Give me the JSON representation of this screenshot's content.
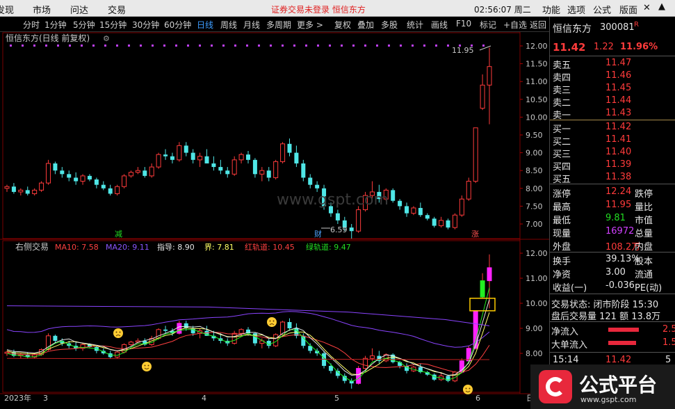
{
  "menu": {
    "items": [
      "发现",
      "市场",
      "问达",
      "交易"
    ],
    "notice": "证券交易未登录  恒信东方",
    "clock": "02:56:07 周二",
    "right_items": [
      "功能",
      "选项",
      "公式",
      "版面"
    ],
    "close": "✕",
    "caret": "▲"
  },
  "toolbar": {
    "items": [
      "分时",
      "1分钟",
      "5分钟",
      "15分钟",
      "30分钟",
      "60分钟",
      "日线",
      "周线",
      "月线",
      "多周期",
      "更多 >",
      "复权",
      "叠加",
      "多股",
      "统计",
      "画线",
      "F10",
      "标记",
      "+自选",
      "返回"
    ],
    "active": "日线"
  },
  "main_chart": {
    "title": "恒信东方(日线 前复权)",
    "high_label": "11.95",
    "low_label": "6.59",
    "markers": {
      "jian": "减",
      "cai": "财",
      "zhang": "涨"
    },
    "y_ticks": [
      "12.00",
      "11.50",
      "11.00",
      "10.50",
      "10.00",
      "9.50",
      "9.00",
      "8.50",
      "8.00",
      "7.50",
      "7.00"
    ]
  },
  "indicator": {
    "name": "右侧交易",
    "ma10_label": "MA10: 7.58",
    "ma20_label": "MA20: 9.11",
    "zhidao_label": "指导: 8.90",
    "jie_label": "界: 7.81",
    "hong_label": "红轨道: 10.45",
    "lv_label": "绿轨道: 9.47",
    "y_ticks": [
      "12.00",
      "11.00",
      "10.00",
      "9.00",
      "8.00"
    ]
  },
  "x_axis": {
    "year": "2023年",
    "months": [
      "3",
      "4",
      "5",
      "6"
    ],
    "end": "日"
  },
  "watermark": "www.gspt.com",
  "chart_data": {
    "type": "candlestick",
    "ylim": [
      6.4,
      12.2
    ],
    "candles": [
      [
        8.0,
        8.1,
        7.9,
        8.05
      ],
      [
        8.05,
        8.15,
        7.85,
        7.9
      ],
      [
        7.9,
        8.0,
        7.8,
        7.95
      ],
      [
        7.95,
        8.05,
        7.8,
        7.85
      ],
      [
        7.85,
        8.0,
        7.8,
        7.95
      ],
      [
        7.95,
        8.2,
        7.9,
        8.15
      ],
      [
        8.15,
        8.8,
        8.1,
        8.7
      ],
      [
        8.7,
        8.75,
        8.4,
        8.5
      ],
      [
        8.5,
        8.6,
        8.3,
        8.4
      ],
      [
        8.4,
        8.5,
        8.2,
        8.3
      ],
      [
        8.3,
        8.45,
        8.1,
        8.2
      ],
      [
        8.2,
        8.4,
        8.1,
        8.35
      ],
      [
        8.35,
        8.4,
        8.2,
        8.25
      ],
      [
        8.25,
        8.3,
        8.0,
        8.1
      ],
      [
        8.1,
        8.2,
        7.95,
        8.0
      ],
      [
        8.0,
        8.1,
        7.8,
        7.85
      ],
      [
        7.85,
        8.1,
        7.8,
        8.05
      ],
      [
        8.05,
        8.4,
        8.0,
        8.35
      ],
      [
        8.35,
        8.5,
        8.3,
        8.45
      ],
      [
        8.45,
        8.6,
        8.4,
        8.5
      ],
      [
        8.5,
        8.6,
        8.3,
        8.35
      ],
      [
        8.35,
        8.7,
        8.3,
        8.6
      ],
      [
        8.6,
        9.0,
        8.55,
        8.95
      ],
      [
        8.95,
        9.1,
        8.8,
        8.9
      ],
      [
        8.9,
        9.0,
        8.7,
        8.8
      ],
      [
        8.8,
        9.3,
        8.75,
        9.2
      ],
      [
        9.2,
        9.3,
        8.9,
        9.0
      ],
      [
        9.0,
        9.1,
        8.7,
        8.8
      ],
      [
        8.8,
        9.0,
        8.6,
        8.9
      ],
      [
        8.9,
        9.1,
        8.7,
        8.7
      ],
      [
        8.7,
        8.9,
        8.5,
        8.6
      ],
      [
        8.6,
        8.8,
        8.4,
        8.5
      ],
      [
        8.5,
        8.6,
        8.3,
        8.4
      ],
      [
        8.4,
        8.9,
        8.35,
        8.8
      ],
      [
        8.8,
        9.0,
        8.7,
        8.95
      ],
      [
        8.95,
        9.05,
        8.7,
        8.8
      ],
      [
        8.8,
        8.85,
        8.3,
        8.4
      ],
      [
        8.4,
        8.6,
        8.2,
        8.5
      ],
      [
        8.5,
        8.6,
        8.2,
        8.3
      ],
      [
        8.3,
        8.8,
        8.25,
        8.75
      ],
      [
        8.75,
        9.3,
        8.7,
        9.25
      ],
      [
        9.25,
        9.4,
        8.9,
        9.0
      ],
      [
        9.0,
        9.2,
        8.6,
        8.7
      ],
      [
        8.7,
        8.8,
        8.2,
        8.3
      ],
      [
        8.3,
        8.4,
        8.0,
        8.1
      ],
      [
        8.1,
        8.2,
        7.9,
        8.0
      ],
      [
        8.0,
        8.1,
        7.4,
        7.5
      ],
      [
        7.5,
        7.6,
        7.2,
        7.3
      ],
      [
        7.3,
        7.4,
        7.0,
        7.1
      ],
      [
        7.1,
        7.2,
        6.8,
        6.9
      ],
      [
        6.9,
        7.0,
        6.59,
        6.8
      ],
      [
        6.8,
        7.5,
        6.75,
        7.4
      ],
      [
        7.4,
        7.9,
        7.35,
        7.8
      ],
      [
        7.8,
        8.2,
        7.7,
        7.9
      ],
      [
        7.9,
        8.1,
        7.6,
        7.7
      ],
      [
        7.7,
        8.0,
        7.65,
        7.95
      ],
      [
        7.95,
        8.0,
        7.6,
        7.65
      ],
      [
        7.65,
        7.7,
        7.4,
        7.5
      ],
      [
        7.5,
        7.6,
        7.2,
        7.3
      ],
      [
        7.3,
        7.5,
        7.25,
        7.45
      ],
      [
        7.45,
        7.6,
        7.2,
        7.25
      ],
      [
        7.25,
        7.3,
        7.1,
        7.15
      ],
      [
        7.15,
        7.2,
        6.9,
        6.95
      ],
      [
        6.95,
        7.2,
        6.9,
        7.1
      ],
      [
        7.1,
        7.15,
        6.85,
        6.9
      ],
      [
        6.9,
        7.3,
        6.85,
        7.25
      ],
      [
        7.25,
        7.8,
        7.2,
        7.7
      ],
      [
        7.7,
        8.3,
        7.65,
        8.2
      ],
      [
        8.2,
        9.7,
        8.15,
        9.7
      ],
      [
        10.25,
        11.2,
        10.2,
        10.9
      ],
      [
        10.9,
        11.95,
        9.8,
        11.42
      ]
    ]
  },
  "panel": {
    "stock_name": "恒信东方",
    "stock_code": "300081",
    "r_mark": "R",
    "price": "11.42",
    "change": "1.22",
    "change_pct": "11.96%",
    "asks": [
      {
        "label": "卖五",
        "price": "11.47"
      },
      {
        "label": "卖四",
        "price": "11.46"
      },
      {
        "label": "卖三",
        "price": "11.45"
      },
      {
        "label": "卖二",
        "price": "11.44"
      },
      {
        "label": "卖一",
        "price": "11.43"
      }
    ],
    "bids": [
      {
        "label": "买一",
        "price": "11.42"
      },
      {
        "label": "买二",
        "price": "11.41"
      },
      {
        "label": "买三",
        "price": "11.40"
      },
      {
        "label": "买四",
        "price": "11.39"
      },
      {
        "label": "买五",
        "price": "11.38"
      }
    ],
    "stats": [
      {
        "l": "涨停",
        "v": "12.24",
        "r": "跌停",
        "vc": "#ff3b3b"
      },
      {
        "l": "最高",
        "v": "11.95",
        "r": "量比",
        "vc": "#ff3b3b"
      },
      {
        "l": "最低",
        "v": "9.81",
        "r": "市值",
        "vc": "#22dd22"
      },
      {
        "l": "现量",
        "v": "16972",
        "r": "总量",
        "vc": "#d040ff"
      },
      {
        "l": "外盘",
        "v": "108.2万",
        "r": "内盘",
        "vc": "#ff3b3b"
      }
    ],
    "stats2": [
      {
        "l": "换手",
        "v": "39.13%",
        "r": "股本"
      },
      {
        "l": "净资",
        "v": "3.00",
        "r": "流通"
      },
      {
        "l": "收益(一)",
        "v": "-0.036",
        "r": "PE(动)"
      }
    ],
    "trade_status": "交易状态: 闭市阶段 15:30",
    "after_hours": "盘后交易量 121  额 13.8万",
    "net_inflow": "净流入",
    "net_inflow_v": "2.5",
    "big_inflow": "大单流入",
    "big_inflow_v": "1.5",
    "tick_time": "15:14",
    "tick_price": "11.42",
    "tick_vol": "5"
  },
  "logo": {
    "text": "公式平台",
    "url": "www.gspt.com"
  },
  "colors": {
    "up": "#ff3b3b",
    "down": "#4fe6e6",
    "bg": "#000000",
    "grid": "#5a0000"
  }
}
